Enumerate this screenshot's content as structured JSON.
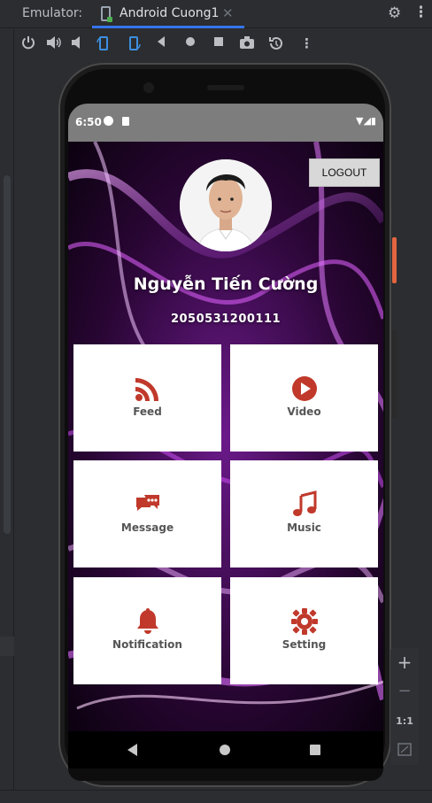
{
  "ide": {
    "emulator_label": "Emulator:",
    "tab_title": "Android Cuong1",
    "tab_close": "✕",
    "toolbar_icons": [
      "power-icon",
      "volume-up-icon",
      "volume-down-icon",
      "rotate-left-icon",
      "rotate-right-icon",
      "back-icon",
      "home-icon",
      "overview-icon",
      "screenshot-icon",
      "snapshot-icon",
      "more-icon"
    ],
    "zoom": {
      "plus": "+",
      "minus": "−",
      "ratio": "1:1"
    }
  },
  "phone": {
    "status_time": "6:50",
    "status_right": "▼◢▮"
  },
  "app": {
    "logout_label": "LOGOUT",
    "user_name": "Nguyễn Tiến Cường",
    "user_id": "2050531200111",
    "tiles": [
      {
        "label": "Feed",
        "icon": "rss-icon"
      },
      {
        "label": "Video",
        "icon": "play-circle-icon"
      },
      {
        "label": "Message",
        "icon": "chat-icon"
      },
      {
        "label": "Music",
        "icon": "music-note-icon"
      },
      {
        "label": "Notification",
        "icon": "bell-icon"
      },
      {
        "label": "Setting",
        "icon": "gear-icon"
      }
    ]
  },
  "colors": {
    "accent": "#c0392b",
    "tile_bg": "#ffffff",
    "statusbar": "#7d7d7d",
    "ide_bg": "#2b2d30",
    "tab_underline": "#3574f0"
  }
}
